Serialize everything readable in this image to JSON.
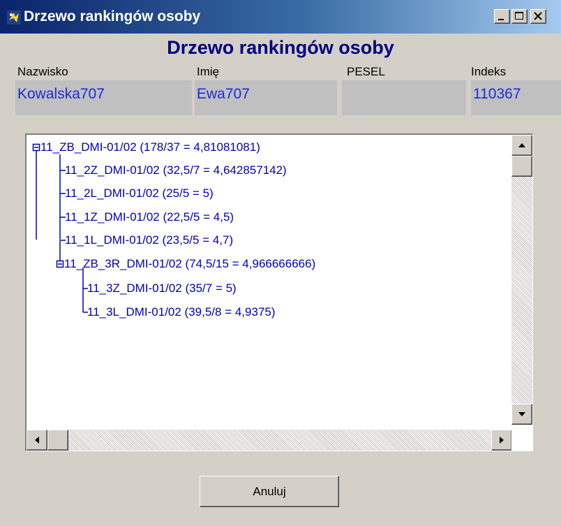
{
  "window": {
    "title": "Drzewo rankingów osoby",
    "controls": [
      "minimize-icon",
      "maximize-icon",
      "close-icon"
    ]
  },
  "heading": "Drzewo rankingów osoby",
  "person": {
    "columns": [
      "Nazwisko",
      "Imię",
      "PESEL",
      "Indeks"
    ],
    "values": [
      "Kowalska707",
      "Ewa707",
      "",
      "110367"
    ]
  },
  "tree": {
    "root": {
      "label": "11_ZB_DMI-01/02 (178/37 = 4,81081081)",
      "expanded": true,
      "children": [
        "11_2Z_DMI-01/02 (32,5/7 = 4,642857142)",
        "11_2L_DMI-01/02 (25/5 = 5)",
        "11_1Z_DMI-01/02 (22,5/5 = 4,5)",
        "11_1L_DMI-01/02 (23,5/5 = 4,7)"
      ]
    },
    "sub": {
      "label": "11_ZB_3R_DMI-01/02 (74,5/15 = 4,966666666)",
      "expanded": true,
      "children": [
        "11_3Z_DMI-01/02 (35/7 = 5)",
        "11_3L_DMI-01/02 (39,5/8 = 4,9375)"
      ]
    }
  },
  "buttons": {
    "cancel": "Anuluj"
  },
  "colors": {
    "title_gradient_start": "#0a246a",
    "title_gradient_end": "#a6caf0",
    "heading": "#000080",
    "tree_text": "#0000c0",
    "field_text": "#1b2bd8",
    "dialog_bg": "#d4d0c8"
  }
}
